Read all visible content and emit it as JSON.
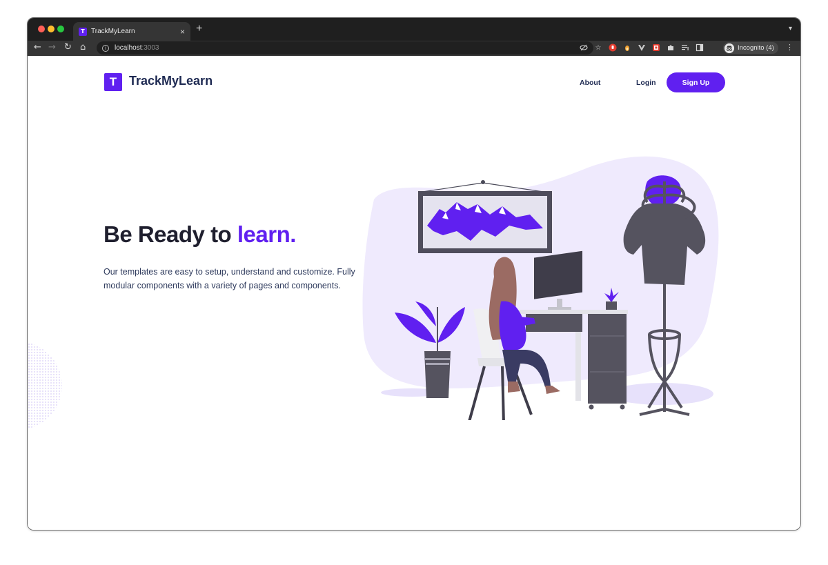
{
  "browser": {
    "tab_title": "TrackMyLearn",
    "tab_favicon": "T",
    "tab_close": "×",
    "new_tab": "+",
    "url_host": "localhost",
    "url_port": ":3003",
    "profile_label": "Incognito (4)",
    "icons": [
      "back-icon",
      "forward-icon",
      "reload-icon",
      "home-icon",
      "info-icon",
      "eye-off-icon",
      "star-icon",
      "extension-red-icon",
      "extension-flame-icon",
      "extension-v-icon",
      "extension-mixed-icon",
      "puzzle-icon",
      "media-list-icon",
      "side-panel-icon",
      "kebab-menu-icon"
    ]
  },
  "nav": {
    "logo_letter": "T",
    "brand": "TrackMyLearn",
    "about": "About",
    "login": "Login",
    "signup": "Sign Up"
  },
  "hero": {
    "headline_main": "Be Ready to ",
    "headline_accent": "learn.",
    "description": "Our templates are easy to setup, understand and customize. Fully modular components with a variety of pages and components."
  },
  "colors": {
    "accent": "#6020f0",
    "navy": "#1e2a52",
    "blob": "#efeafd"
  }
}
